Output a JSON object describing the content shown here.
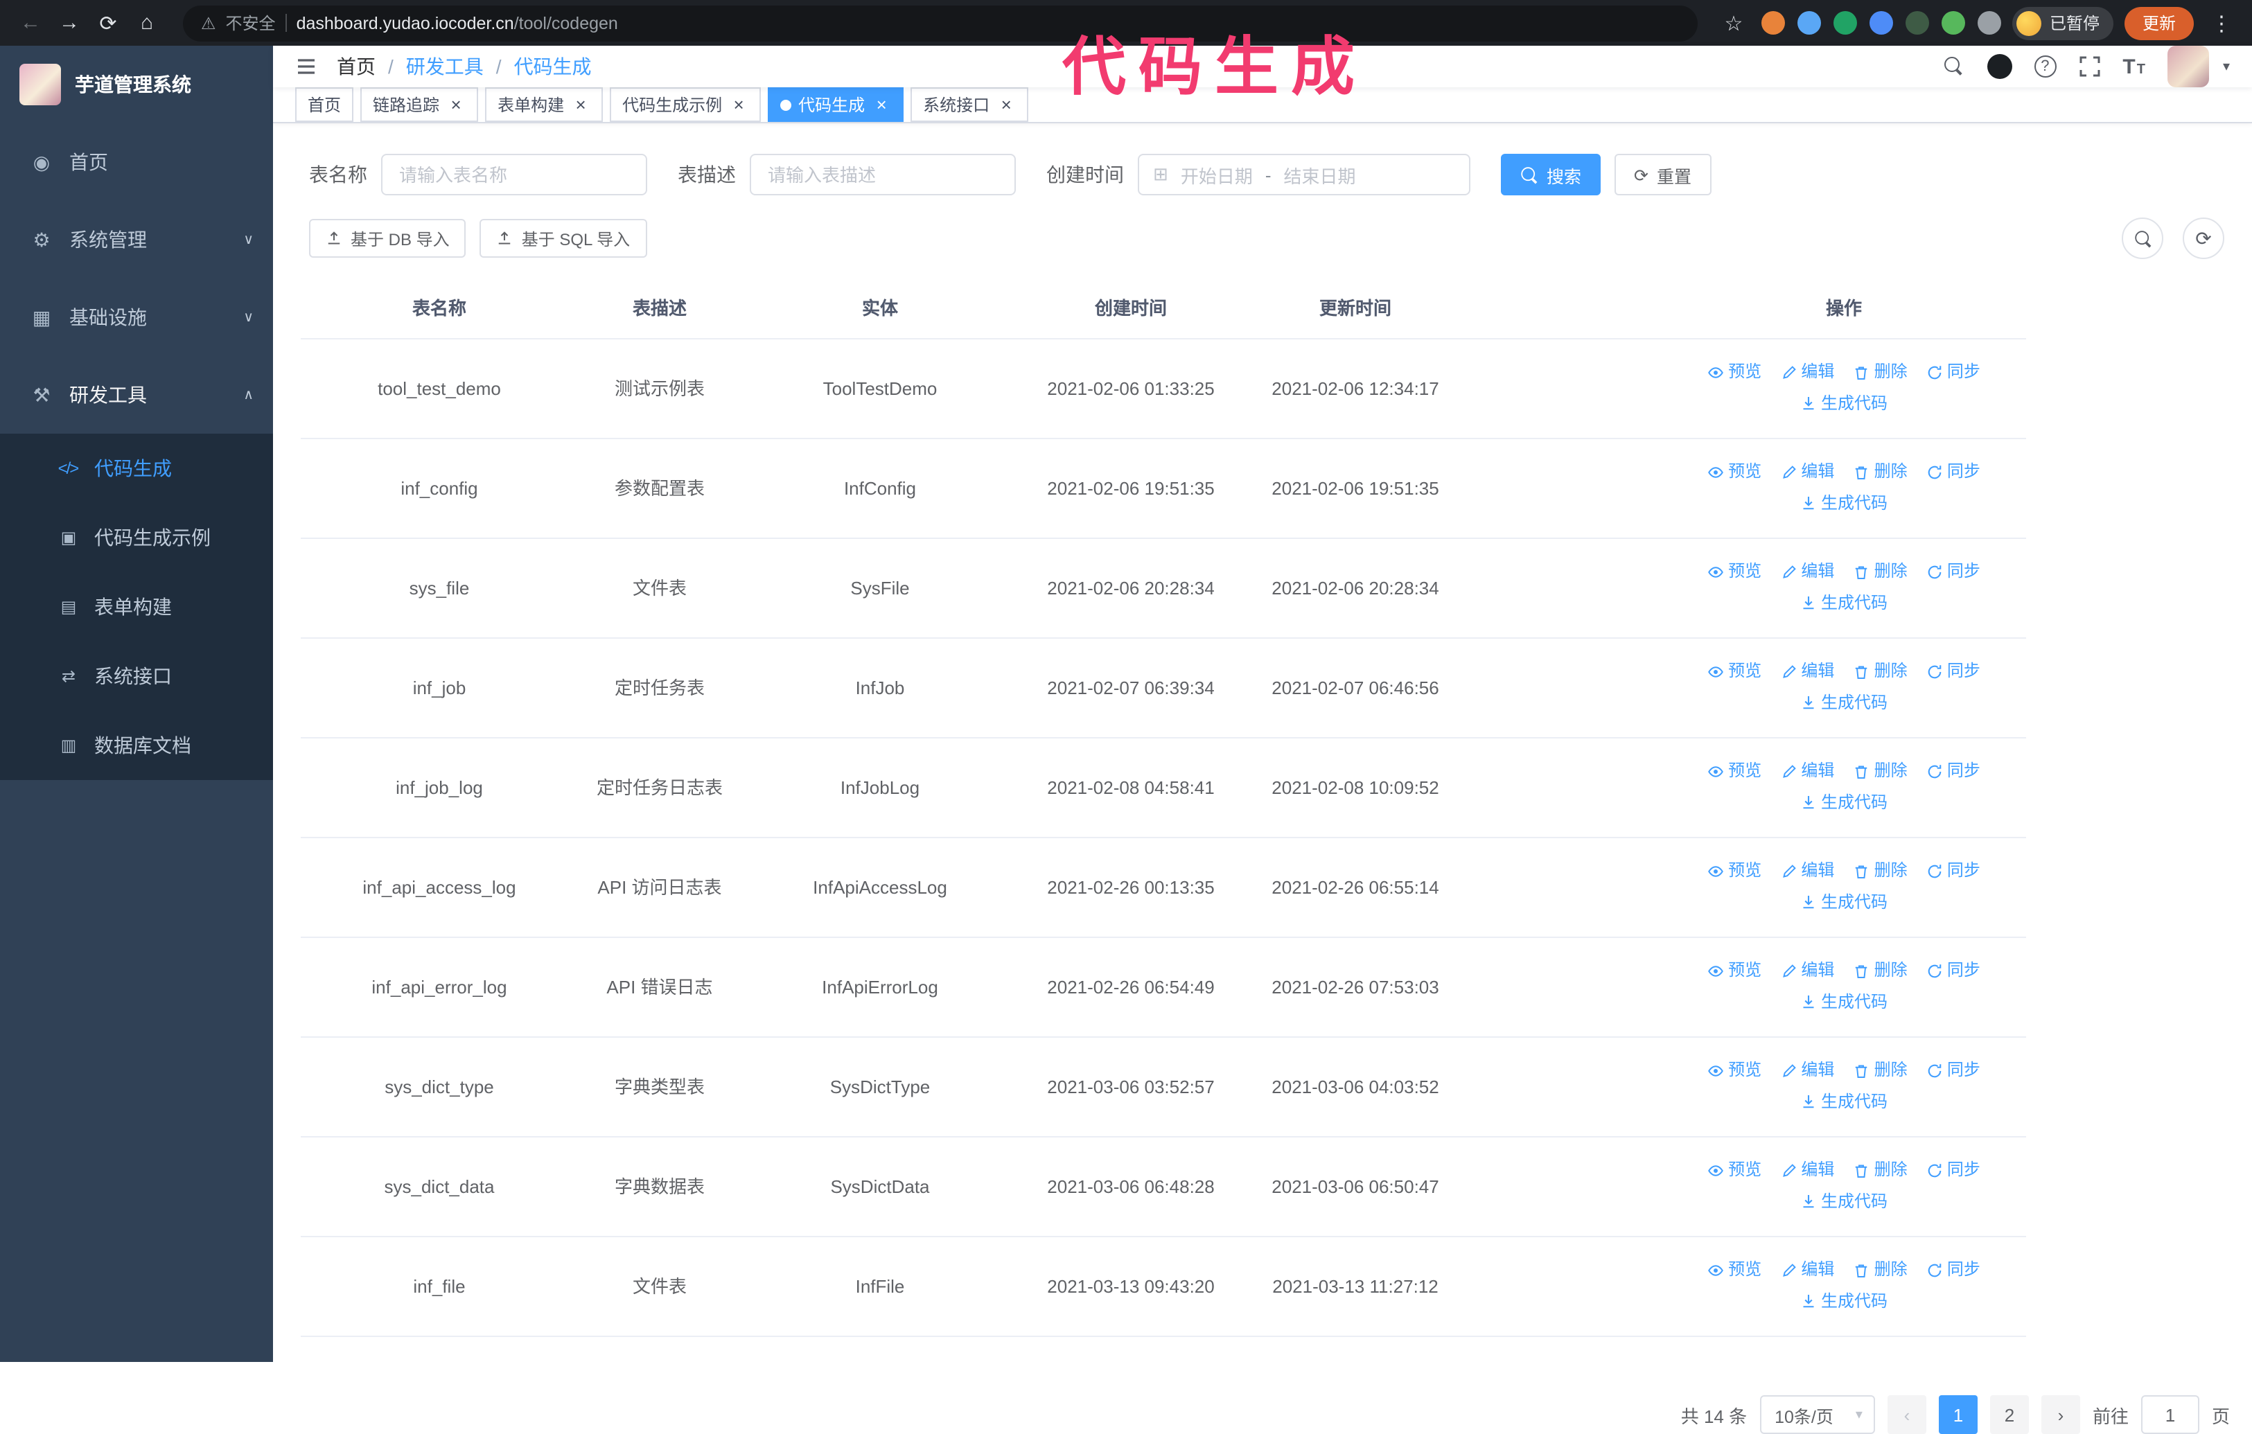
{
  "colors": {
    "accent": "#409eff",
    "sidebar": "#304156",
    "submenu": "#1f2d3d"
  },
  "annotation": {
    "text": "代码生成",
    "color": "#f23b6f"
  },
  "icons": {
    "back": "←",
    "forward": "→",
    "reload": "⟳",
    "home": "⌂",
    "warning": "⚠",
    "star": "☆",
    "dots": "⋮",
    "close": "×",
    "question": "?",
    "caret_down": "▾",
    "chevron_down": "∨",
    "chevron_up": "∧",
    "chevron_left": "‹",
    "chevron_right": "›",
    "refresh": "⟳",
    "calendar": "⊞",
    "separator": "/",
    "font_big": "T",
    "font_small": "T"
  },
  "browser": {
    "security_warning": "不安全",
    "url_domain": "dashboard.yudao.iocoder.cn",
    "url_path": "/tool/codegen",
    "paused_badge": "已暂停",
    "update_button": "更新",
    "extensions": [
      {
        "name": "extension-orange",
        "color": "#e8833a"
      },
      {
        "name": "extension-blue-drop",
        "color": "#5aa7f5"
      },
      {
        "name": "extension-green-check",
        "color": "#21a365"
      },
      {
        "name": "extension-people",
        "color": "#4e8cf7"
      },
      {
        "name": "extension-dark-leaf",
        "color": "#3e5b45"
      },
      {
        "name": "extension-green-leaf",
        "color": "#57b85c"
      },
      {
        "name": "extension-puzzle",
        "color": "#9aa0a6"
      }
    ]
  },
  "sidebar": {
    "logo_title": "芋道管理系统",
    "items": [
      {
        "icon": "◉",
        "label": "首页"
      },
      {
        "icon": "⚙",
        "label": "系统管理",
        "chevron": "∨"
      },
      {
        "icon": "▦",
        "label": "基础设施",
        "chevron": "∨"
      },
      {
        "icon": "⚒",
        "label": "研发工具",
        "chevron": "∧",
        "open": true
      }
    ],
    "submenu": [
      {
        "icon": "</>",
        "label": "代码生成",
        "active": true
      },
      {
        "icon": "▣",
        "label": "代码生成示例"
      },
      {
        "icon": "▤",
        "label": "表单构建"
      },
      {
        "icon": "⇄",
        "label": "系统接口"
      },
      {
        "icon": "▥",
        "label": "数据库文档"
      }
    ]
  },
  "header": {
    "breadcrumb": [
      {
        "label": "首页"
      },
      {
        "label": "研发工具",
        "link": true
      },
      {
        "label": "代码生成",
        "link": true
      }
    ]
  },
  "tabs": [
    {
      "label": "首页",
      "pinned": true
    },
    {
      "label": "链路追踪"
    },
    {
      "label": "表单构建"
    },
    {
      "label": "代码生成示例"
    },
    {
      "label": "代码生成",
      "active": true
    },
    {
      "label": "系统接口"
    }
  ],
  "filters": {
    "table_name_label": "表名称",
    "table_name_placeholder": "请输入表名称",
    "table_desc_label": "表描述",
    "table_desc_placeholder": "请输入表描述",
    "create_time_label": "创建时间",
    "date_start_placeholder": "开始日期",
    "date_separator": "-",
    "date_end_placeholder": "结束日期",
    "search_button": "搜索",
    "reset_button": "重置"
  },
  "toolbar": {
    "import_db_button": "基于 DB 导入",
    "import_sql_button": "基于 SQL 导入"
  },
  "table": {
    "columns": [
      "表名称",
      "表描述",
      "实体",
      "创建时间",
      "更新时间",
      "操作"
    ],
    "actions": [
      "预览",
      "编辑",
      "删除",
      "同步",
      "生成代码"
    ],
    "rows": [
      {
        "name": "tool_test_demo",
        "desc": "测试示例表",
        "entity": "ToolTestDemo",
        "created": "2021-02-06 01:33:25",
        "updated": "2021-02-06 12:34:17"
      },
      {
        "name": "inf_config",
        "desc": "参数配置表",
        "entity": "InfConfig",
        "created": "2021-02-06 19:51:35",
        "updated": "2021-02-06 19:51:35"
      },
      {
        "name": "sys_file",
        "desc": "文件表",
        "entity": "SysFile",
        "created": "2021-02-06 20:28:34",
        "updated": "2021-02-06 20:28:34",
        "created_2l": true,
        "updated_2l": true
      },
      {
        "name": "inf_job",
        "desc": "定时任务表",
        "entity": "InfJob",
        "created": "2021-02-07 06:39:34",
        "updated": "2021-02-07 06:46:56",
        "created_2l": true,
        "updated_2l": true
      },
      {
        "name": "inf_job_log",
        "desc": "定时任务日志表",
        "entity": "InfJobLog",
        "created": "2021-02-08 04:58:41",
        "updated": "2021-02-08 10:09:52",
        "created_2l": true,
        "updated_2l": true
      },
      {
        "name": "inf_api_access_log",
        "desc": "API 访问日志表",
        "entity": "InfApiAccessLog",
        "created": "2021-02-26 00:13:35",
        "updated": "2021-02-26 06:55:14",
        "updated_2l": true
      },
      {
        "name": "inf_api_error_log",
        "desc": "API 错误日志",
        "entity": "InfApiErrorLog",
        "created": "2021-02-26 06:54:49",
        "updated": "2021-02-26 07:53:03",
        "created_2l": true,
        "updated_2l": true
      },
      {
        "name": "sys_dict_type",
        "desc": "字典类型表",
        "entity": "SysDictType",
        "created": "2021-03-06 03:52:57",
        "updated": "2021-03-06 04:03:52",
        "created_2l": true,
        "updated_2l": true
      },
      {
        "name": "sys_dict_data",
        "desc": "字典数据表",
        "entity": "SysDictData",
        "created": "2021-03-06 06:48:28",
        "updated": "2021-03-06 06:50:47",
        "created_2l": true,
        "updated_2l": true
      },
      {
        "name": "inf_file",
        "desc": "文件表",
        "entity": "InfFile",
        "created": "2021-03-13 09:43:20",
        "updated": "2021-03-13 11:27:12",
        "created_2l": true
      }
    ]
  },
  "pagination": {
    "total_text": "共 14 条",
    "page_size": "10条/页",
    "pages": [
      {
        "label": "1",
        "active": true
      },
      {
        "label": "2"
      }
    ],
    "goto_label": "前往",
    "goto_value": "1",
    "goto_suffix": "页"
  }
}
